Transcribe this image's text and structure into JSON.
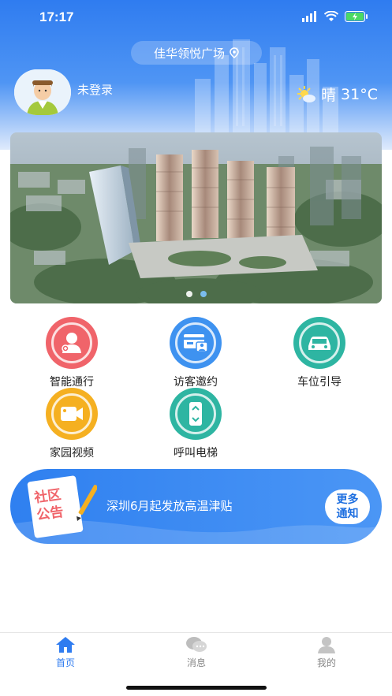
{
  "status": {
    "time": "17:17"
  },
  "header": {
    "location": "佳华领悦广场",
    "login_status": "未登录",
    "weather": {
      "condition": "晴",
      "temperature": "31°C"
    }
  },
  "banner": {
    "slides": 2,
    "active_index": 1
  },
  "features": [
    {
      "label": "智能通行",
      "icon": "smart-access-icon",
      "color": "#f0646a"
    },
    {
      "label": "访客邀约",
      "icon": "visitor-invite-icon",
      "color": "#3e92f0"
    },
    {
      "label": "车位引导",
      "icon": "parking-guide-icon",
      "color": "#2eb5a2"
    },
    {
      "label": "家园视频",
      "icon": "home-video-icon",
      "color": "#f5b021"
    },
    {
      "label": "呼叫电梯",
      "icon": "call-elevator-icon",
      "color": "#2eb5a2"
    }
  ],
  "notice": {
    "badge_line1": "社区",
    "badge_line2": "公告",
    "text": "深圳6月起发放高温津贴",
    "more_line1": "更多",
    "more_line2": "通知"
  },
  "tabbar": {
    "items": [
      {
        "label": "首页",
        "icon": "home-icon",
        "active": true
      },
      {
        "label": "消息",
        "icon": "message-icon",
        "active": false
      },
      {
        "label": "我的",
        "icon": "profile-icon",
        "active": false
      }
    ]
  },
  "colors": {
    "primary": "#2f7cf0",
    "tab_active": "#2f7cf0",
    "tab_inactive": "#888888"
  }
}
